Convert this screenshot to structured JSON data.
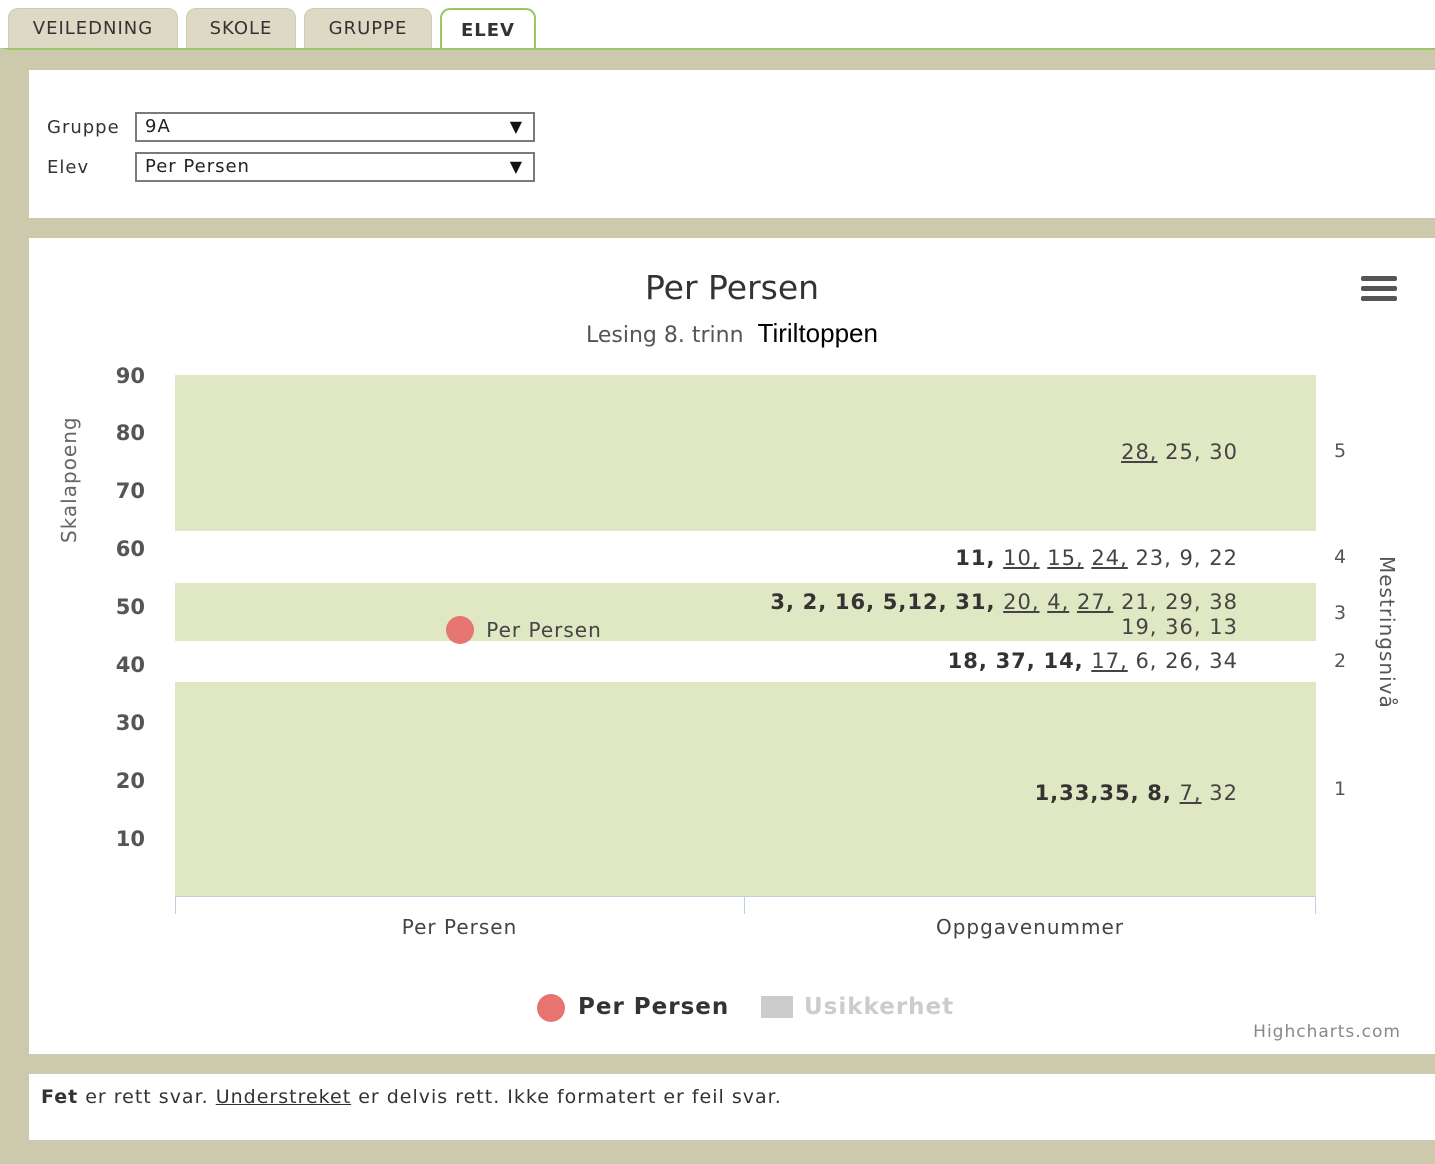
{
  "tabs": [
    {
      "label": "VEILEDNING"
    },
    {
      "label": "SKOLE"
    },
    {
      "label": "GRUPPE"
    },
    {
      "label": "ELEV"
    }
  ],
  "filters": {
    "group_label": "Gruppe",
    "group_value": "9A",
    "student_label": "Elev",
    "student_value": "Per Persen"
  },
  "chart_data": {
    "type": "scatter",
    "title": "Per Persen",
    "subtitle": "Lesing 8. trinn",
    "subtitle_extra": "Tiriltoppen",
    "ylabel": "Skalapoeng",
    "ylabel_right": "Mestringsnivå",
    "ylim": [
      0,
      90
    ],
    "yticks": [
      "90",
      "80",
      "70",
      "60",
      "50",
      "40",
      "30",
      "20",
      "10"
    ],
    "categories": [
      "Per Persen",
      "Oppgavenummer"
    ],
    "series": [
      {
        "name": "Per Persen",
        "points": [
          {
            "x": "Per Persen",
            "y": 46
          }
        ],
        "color": "#e67470"
      },
      {
        "name": "Usikkerhet",
        "color": "#cccccc"
      }
    ],
    "point_label": "Per Persen",
    "levels": [
      "5",
      "4",
      "3",
      "2",
      "1"
    ],
    "bands_color": "#dfe8c3",
    "legend_placement": "bottom-center",
    "credits": "Highcharts.com"
  },
  "tasks": {
    "level5": {
      "underlined": [
        "28,"
      ],
      "plain": [
        "25,",
        "30"
      ]
    },
    "level4": {
      "bold": [
        "11,"
      ],
      "underlined": [
        "10,",
        "15,",
        "24,"
      ],
      "plain": [
        "23,",
        "9,",
        "22"
      ]
    },
    "level3": {
      "bold": [
        "3,",
        "2,",
        "16,",
        "5,",
        "12,",
        "31,"
      ],
      "underlined": [
        "20,",
        "4,",
        "27,"
      ],
      "plain": [
        "21,",
        "29,",
        "38"
      ]
    },
    "level3b": {
      "plain": [
        "19,",
        "36,",
        "13"
      ]
    },
    "level2": {
      "bold": [
        "18,",
        "37,",
        "14,"
      ],
      "underlined": [
        "17,"
      ],
      "plain": [
        "6,",
        "26,",
        "34"
      ]
    },
    "level1": {
      "bold": [
        "1,",
        "33,",
        "35,",
        "8,"
      ],
      "underlined": [
        "7,"
      ],
      "plain": [
        "32"
      ]
    }
  },
  "note": {
    "bold": "Fet",
    "t1": " er rett svar. ",
    "underlined": "Understreket",
    "t2": " er delvis rett. Ikke formatert er feil svar."
  }
}
